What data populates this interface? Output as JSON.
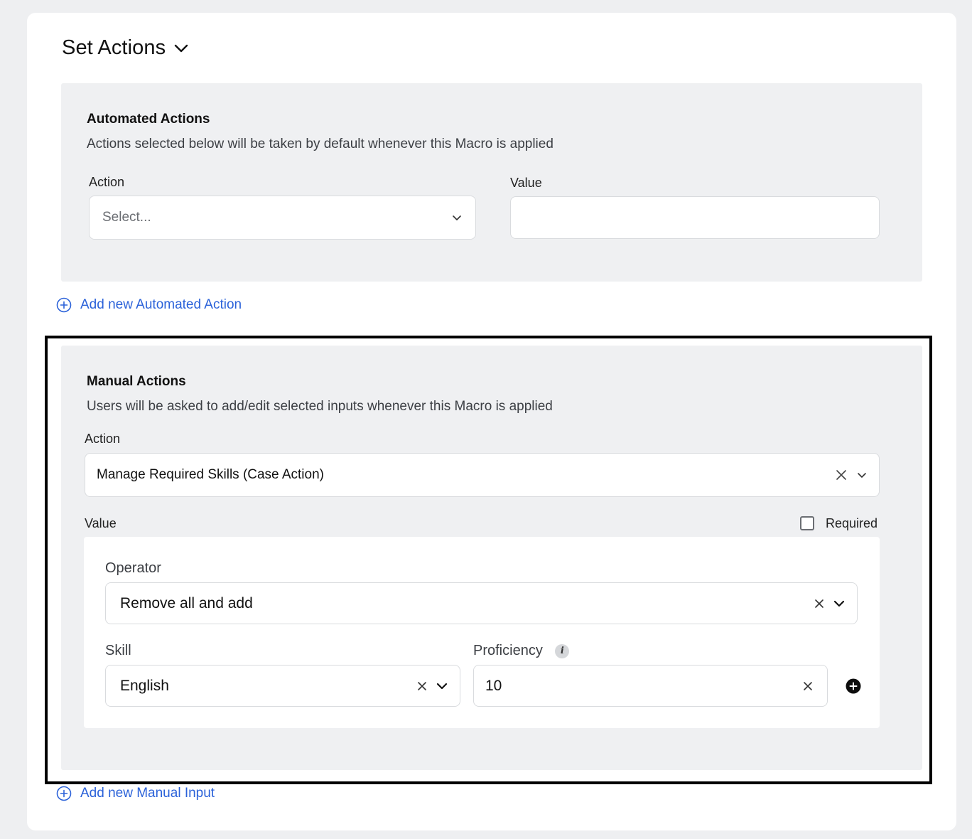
{
  "header": {
    "title": "Set Actions"
  },
  "automated": {
    "title": "Automated Actions",
    "description": "Actions selected below will be taken by default whenever this Macro is applied",
    "action_label": "Action",
    "action_placeholder": "Select...",
    "value_label": "Value",
    "value_value": "",
    "add_link": "Add new Automated Action"
  },
  "manual": {
    "title": "Manual Actions",
    "description": "Users will be asked to add/edit selected inputs whenever this Macro is applied",
    "action_label": "Action",
    "action_value": "Manage Required Skills (Case Action)",
    "value_label": "Value",
    "required_label": "Required",
    "required_checked": false,
    "operator_label": "Operator",
    "operator_value": "Remove all and add",
    "skill_label": "Skill",
    "skill_value": "English",
    "proficiency_label": "Proficiency",
    "proficiency_info_icon": "i",
    "proficiency_value": "10",
    "add_link": "Add new Manual Input"
  },
  "colors": {
    "link": "#2b62d9",
    "panel": "#eff0f2",
    "page": "#eeeff1"
  },
  "icons": [
    "chevron-down-icon",
    "clear-icon",
    "plus-circle-icon",
    "add-row-icon",
    "info-icon"
  ]
}
